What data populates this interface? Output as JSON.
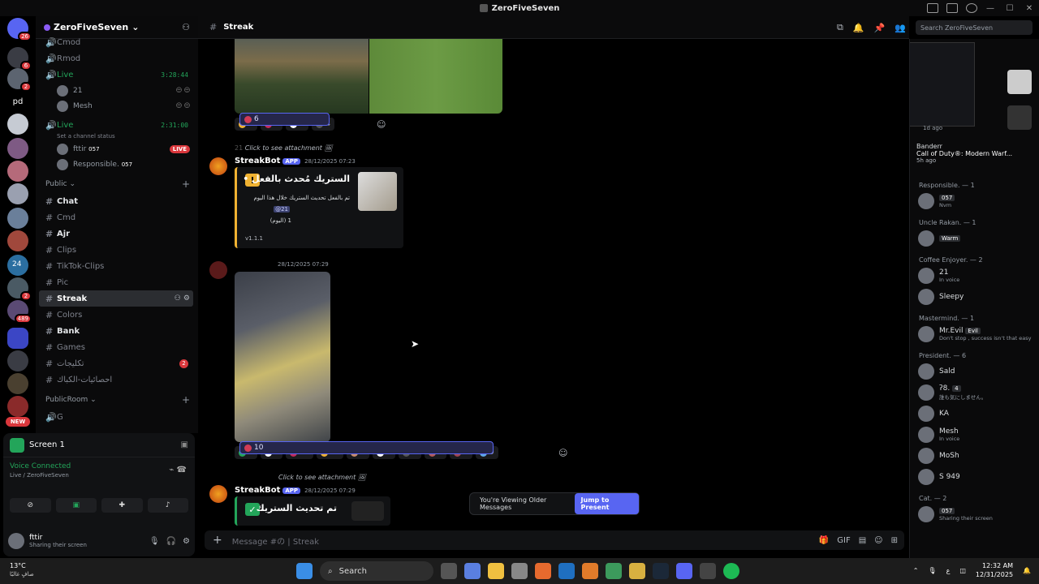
{
  "window": {
    "title": "ZeroFiveSeven"
  },
  "server": {
    "name": "ZeroFiveSeven"
  },
  "guild_badges": [
    "26",
    "6",
    "2",
    "pd",
    "24",
    "2",
    "489",
    "NEW"
  ],
  "channels": {
    "top": [
      {
        "name": "Cmod"
      },
      {
        "name": "Rmod"
      }
    ],
    "live1": {
      "name": "Live",
      "time": "3:28:44",
      "users": [
        "21",
        "Mesh"
      ]
    },
    "live2": {
      "name": "Live",
      "time": "2:31:00",
      "status": "Set a channel status",
      "users": [
        {
          "name": "fttir",
          "tag": "057",
          "badge": "LIVE"
        },
        {
          "name": "Responsible.",
          "tag": "057"
        }
      ]
    },
    "public_label": "Public",
    "public": [
      {
        "name": "Chat",
        "bright": true
      },
      {
        "name": "Cmd",
        "bright": false
      },
      {
        "name": "Ajr",
        "bright": true
      },
      {
        "name": "Clips",
        "bright": false
      },
      {
        "name": "TikTok-Clips",
        "bright": false
      },
      {
        "name": "Pic",
        "bright": false
      },
      {
        "name": "Streak",
        "bright": true,
        "selected": true
      },
      {
        "name": "Colors",
        "bright": false
      },
      {
        "name": "Bank",
        "bright": true
      },
      {
        "name": "Games",
        "bright": false
      },
      {
        "name": "تكليجات",
        "bright": false,
        "count": "2"
      },
      {
        "name": "احصائيات-الكباك",
        "bright": false
      }
    ],
    "publicroom_label": "PublicRoom",
    "publicroom_first": "G"
  },
  "user_panel": {
    "screen_label": "Screen 1",
    "voice_status": "Voice Connected",
    "voice_channel": "Live / ZeroFiveSeven",
    "username": "fttir",
    "user_status": "Sharing their screen"
  },
  "chat_header": {
    "channel": "Streak",
    "search_placeholder": "Search ZeroFiveSeven"
  },
  "messages": {
    "reactions1": [
      {
        "emoji": "warning",
        "count": "1",
        "color": "#f0b232"
      },
      {
        "emoji": "heart-ribbon",
        "count": "6",
        "color": "#c42a5c"
      },
      {
        "emoji": "rose",
        "count": "6",
        "color": "#d23b56",
        "mine": true
      },
      {
        "emoji": "white-heart",
        "count": "4",
        "color": "#ffffff"
      },
      {
        "emoji": "figure",
        "count": "4",
        "color": "#555555"
      }
    ],
    "reply1": "Click to see attachment",
    "reply1_user": "21",
    "msg1": {
      "author": "StreakBot",
      "app": "APP",
      "timestamp": "28/12/2025 07:23",
      "embed_title": "الستريك مُحدث بالفعل •",
      "embed_desc": "تم بالفعل تحديث الستريك خلال هذا اليوم",
      "embed_mention": "@21",
      "embed_line": "1 (اليوم)",
      "embed_version": "v1.1.1"
    },
    "msg2": {
      "timestamp": "28/12/2025 07:29"
    },
    "reactions2": [
      {
        "emoji": "check",
        "count": "4",
        "color": "#23a55a"
      },
      {
        "emoji": "white-heart",
        "count": "9",
        "color": "#ffffff"
      },
      {
        "emoji": "heart-ribbon",
        "count": "11",
        "color": "#c42a5c"
      },
      {
        "emoji": "sparkle",
        "count": "10",
        "color": "#f0b232"
      },
      {
        "emoji": "person",
        "count": "7",
        "color": "#c98c6b"
      },
      {
        "emoji": "white-heart",
        "count": "8",
        "color": "#ffffff"
      },
      {
        "emoji": "figure",
        "count": "7",
        "color": "#555555"
      },
      {
        "emoji": "face",
        "count": "8",
        "color": "#b45a5a"
      },
      {
        "emoji": "face2",
        "count": "8",
        "color": "#a0454f"
      },
      {
        "emoji": "rose",
        "count": "10",
        "color": "#d23b56",
        "mine": true
      },
      {
        "emoji": "blue-heart",
        "count": "9",
        "color": "#5fa8e8"
      }
    ],
    "reply2": "Click to see attachment",
    "msg3": {
      "author": "StreakBot",
      "app": "APP",
      "timestamp": "28/12/2025 07:29",
      "embed_title": "تم تحديث الستريك"
    },
    "older_text": "You're Viewing Older Messages",
    "jump_label": "Jump to Present"
  },
  "composer": {
    "placeholder": "Message #の | Streak"
  },
  "members": {
    "activity_ago": "1d ago",
    "game_user": "Banderr",
    "game_title": "Call of Duty®: Modern Warf...",
    "game_ago": "5h ago",
    "groups": [
      {
        "label": "Responsible. — 1",
        "members": [
          {
            "name": "",
            "sub": "Nvm",
            "tag": "057"
          }
        ]
      },
      {
        "label": "Uncle Rakan. — 1",
        "members": [
          {
            "name": "",
            "sub": "",
            "tag": "Warm"
          }
        ]
      },
      {
        "label": "Coffee Enjoyer. — 2",
        "members": [
          {
            "name": "21",
            "sub": "In voice"
          },
          {
            "name": "Sleepy",
            "sub": ""
          }
        ]
      },
      {
        "label": "Mastermind. — 1",
        "members": [
          {
            "name": "Mr.Evil",
            "sub": "Don't stop , success isn't that easy",
            "tag": "Evil"
          }
        ]
      },
      {
        "label": "President. — 6",
        "members": [
          {
            "name": "Sald",
            "sub": ""
          },
          {
            "name": "ʔ8.",
            "sub": "誰も気にしません。",
            "tag": "4"
          },
          {
            "name": "KA",
            "sub": ""
          },
          {
            "name": "Mesh",
            "sub": "In voice"
          },
          {
            "name": "MoSh",
            "sub": ""
          },
          {
            "name": "S 949",
            "sub": ""
          }
        ]
      },
      {
        "label": "Cat. — 2",
        "members": [
          {
            "name": "",
            "sub": "Sharing their screen",
            "tag": "057"
          }
        ]
      }
    ]
  },
  "taskbar": {
    "temp": "13°C",
    "weather": "صافٍ غالبًا",
    "search_label": "Search",
    "time": "12:32 AM",
    "date": "12/31/2025",
    "lang": "ع"
  }
}
